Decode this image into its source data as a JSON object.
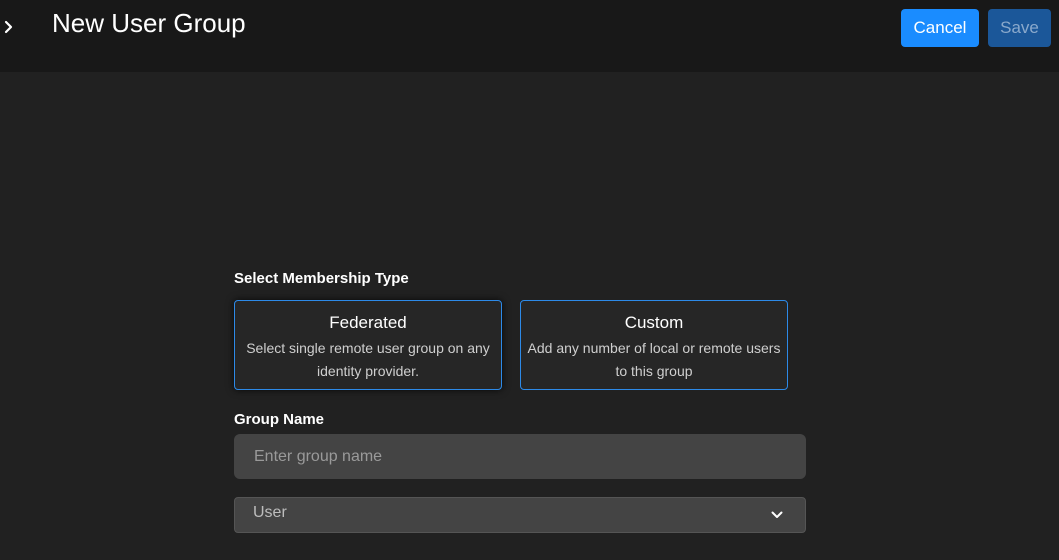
{
  "header": {
    "title": "New User Group",
    "cancel_label": "Cancel",
    "save_label": "Save",
    "expand_icon": "chevron-right-icon"
  },
  "membership": {
    "section_label": "Select Membership Type",
    "options": [
      {
        "title": "Federated",
        "description": "Select single remote user group on any identity provider."
      },
      {
        "title": "Custom",
        "description": "Add any number of local or remote users to this group"
      }
    ]
  },
  "group_name": {
    "label": "Group Name",
    "placeholder": "Enter group name",
    "value": ""
  },
  "role_select": {
    "selected": "User",
    "icon": "chevron-down-icon"
  },
  "colors": {
    "background": "#212121",
    "header_background": "#181818",
    "accent": "#1a8cff",
    "save_disabled": "#1b5799",
    "card_border": "#2d8ae8",
    "input_background": "#444444"
  }
}
